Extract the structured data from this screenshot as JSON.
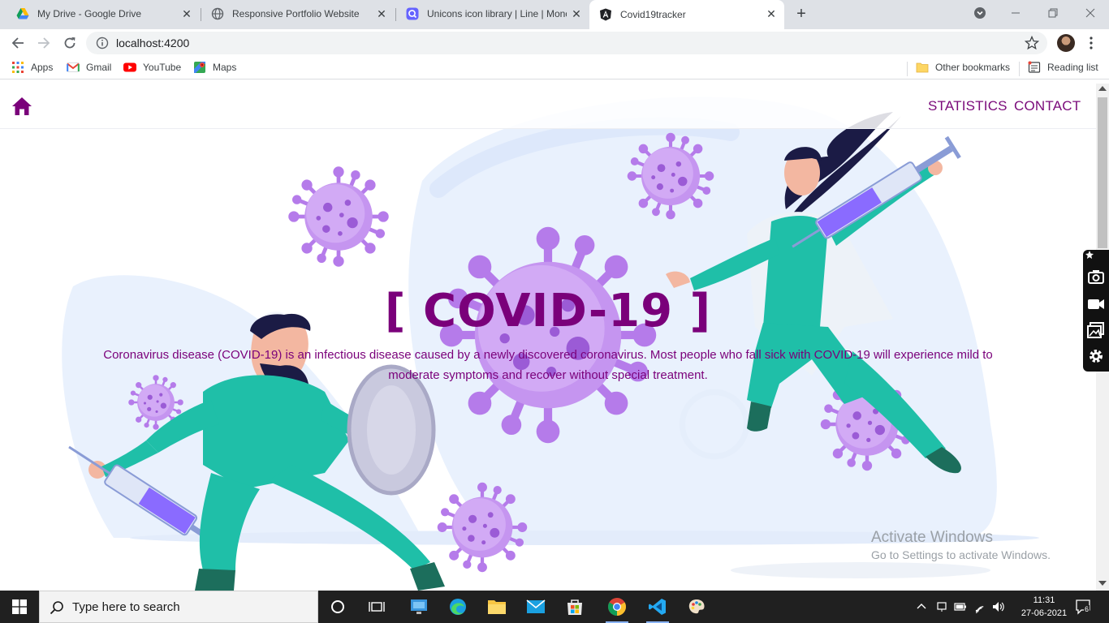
{
  "browser": {
    "tabs": [
      {
        "title": "My Drive - Google Drive",
        "icon": "google-drive-icon",
        "active": false
      },
      {
        "title": "Responsive Portfolio Website",
        "icon": "globe-icon",
        "active": false
      },
      {
        "title": "Unicons icon library | Line | Monc",
        "icon": "unicons-icon",
        "active": false
      },
      {
        "title": "Covid19tracker",
        "icon": "angular-icon",
        "active": true
      }
    ],
    "url": "localhost:4200",
    "bookmarks": {
      "apps": "Apps",
      "gmail": "Gmail",
      "youtube": "YouTube",
      "maps": "Maps",
      "other": "Other bookmarks",
      "reading_list": "Reading list"
    }
  },
  "site": {
    "nav": {
      "statistics": "STATISTICS",
      "contact": "CONTACT"
    },
    "hero": {
      "title": "[ COVID-19 ]",
      "description": "Coronavirus disease (COVID-19) is an infectious disease caused by a newly discovered coronavirus. Most people who fall sick with COVID-19 will experience mild to moderate symptoms and recover without special treatment."
    },
    "colors": {
      "brand": "#7a007a",
      "virus": "#b57bea",
      "scrubs": "#1fbfa8",
      "backdrop": "#e8f0fc"
    }
  },
  "watermark": {
    "title": "Activate Windows",
    "subtitle": "Go to Settings to activate Windows."
  },
  "taskbar": {
    "search_placeholder": "Type here to search",
    "time": "11:31",
    "date": "27-06-2021",
    "notification_count": "6"
  }
}
